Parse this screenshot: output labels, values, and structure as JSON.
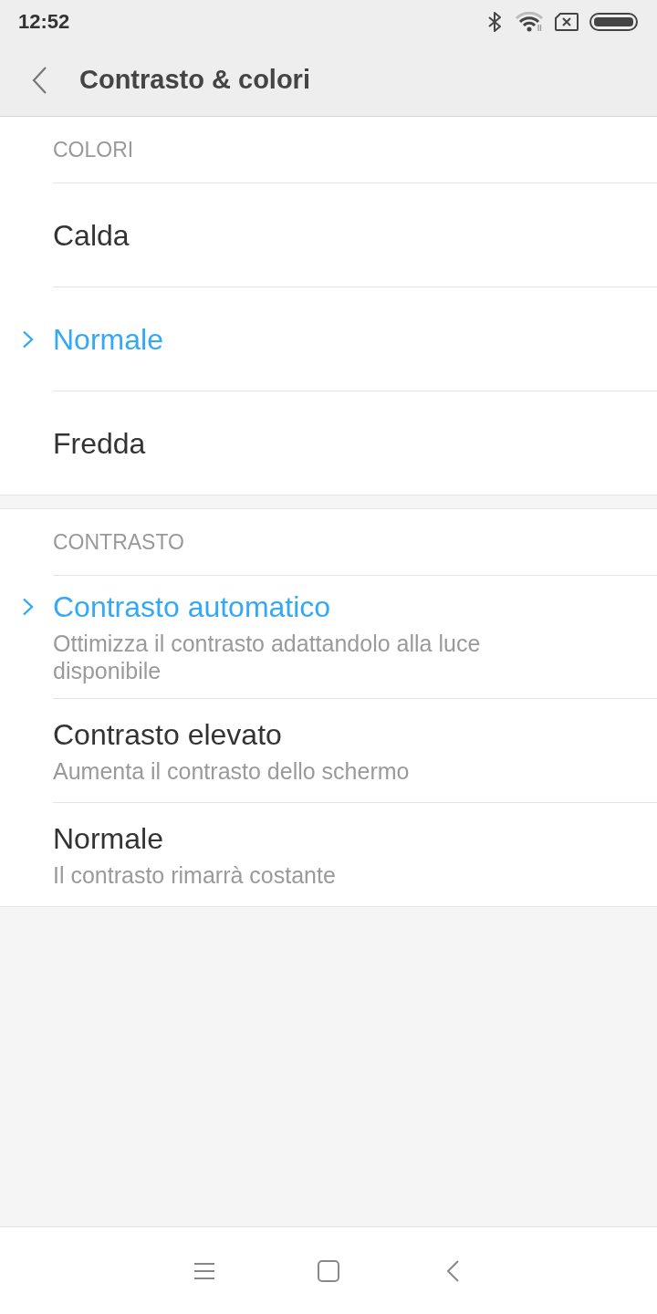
{
  "status_bar": {
    "time": "12:52"
  },
  "toolbar": {
    "title": "Contrasto & colori"
  },
  "sections": [
    {
      "header": "COLORI",
      "items": [
        {
          "label": "Calda",
          "selected": false
        },
        {
          "label": "Normale",
          "selected": true
        },
        {
          "label": "Fredda",
          "selected": false
        }
      ]
    },
    {
      "header": "CONTRASTO",
      "items": [
        {
          "label": "Contrasto automatico",
          "description": "Ottimizza il contrasto adattandolo alla luce disponibile",
          "selected": true
        },
        {
          "label": "Contrasto elevato",
          "description": "Aumenta il contrasto dello schermo",
          "selected": false
        },
        {
          "label": "Normale",
          "description": "Il contrasto rimarrà costante",
          "selected": false
        }
      ]
    }
  ]
}
